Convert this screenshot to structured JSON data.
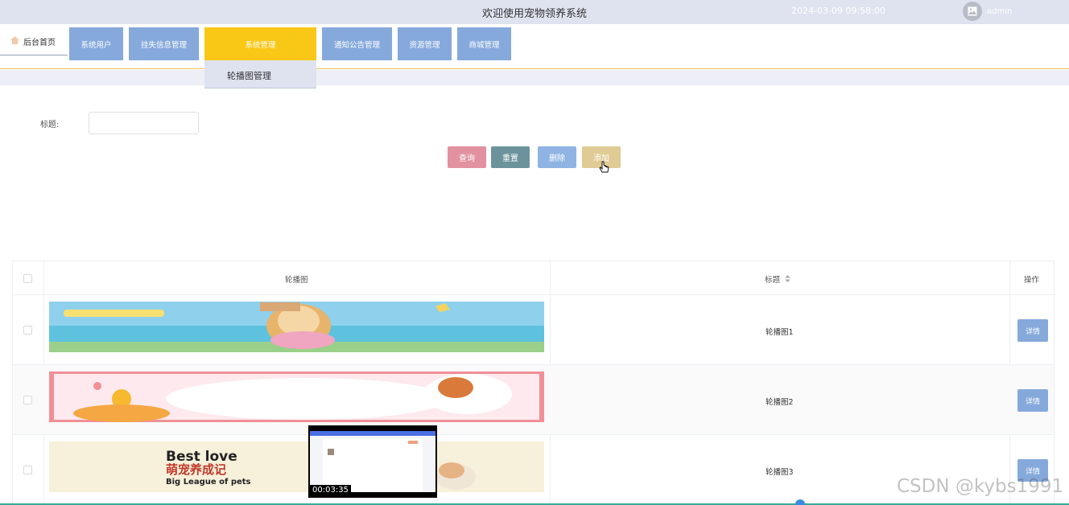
{
  "header": {
    "title": "欢迎使用宠物领养系统",
    "datetime": "2024-03-09 09:58:00",
    "username": "admin"
  },
  "nav": {
    "home_label": "后台首页",
    "items": [
      {
        "label": "系统用户"
      },
      {
        "label": "挂失信息管理"
      },
      {
        "label": "系统管理",
        "active": true
      },
      {
        "label": "通知公告管理"
      },
      {
        "label": "资源管理"
      },
      {
        "label": "商城管理"
      }
    ],
    "submenu": [
      "轮播图管理"
    ]
  },
  "search": {
    "title_label": "标题:",
    "title_value": "",
    "title_placeholder": ""
  },
  "actions": {
    "query": "查询",
    "reset": "重置",
    "delete": "删除",
    "add": "添加"
  },
  "table": {
    "headers": {
      "image": "轮播图",
      "title": "标题",
      "actions": "操作"
    },
    "rows": [
      {
        "title": "轮播图1",
        "detail": "详情"
      },
      {
        "title": "轮播图2",
        "detail": "详情"
      },
      {
        "title": "轮播图3",
        "detail": "详情"
      }
    ],
    "banner3_text": {
      "line1": "Best love",
      "line2": "萌宠养成记",
      "line3": "Big League of pets"
    }
  },
  "video_overlay": {
    "timestamp": "00:03:35"
  },
  "watermark": "CSDN @kybs1991",
  "colors": {
    "nav_button": "#86a9dc",
    "nav_active": "#f9c716",
    "query": "#e1919f",
    "reset": "#6c939c",
    "delete": "#8fb4e3",
    "add": "#dfcb93"
  }
}
